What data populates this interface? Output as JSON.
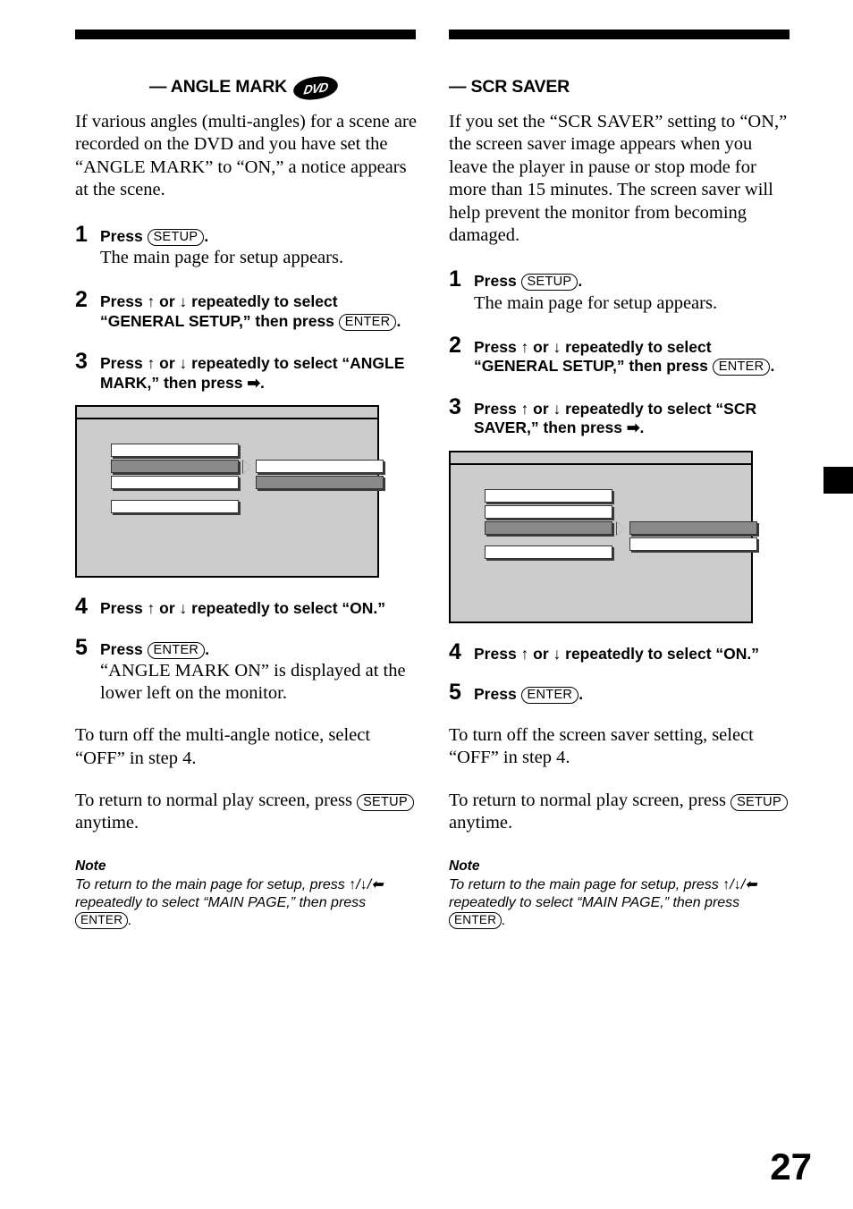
{
  "page": {
    "number": "27",
    "edge_tab_color": "#000000"
  },
  "left_column": {
    "heading": "— ANGLE MARK",
    "heading_badge": "DVD",
    "intro": "If various angles (multi-angles) for a scene are recorded on the DVD and you have set the “ANGLE MARK” to “ON,” a notice appears at the scene.",
    "steps": [
      {
        "num": "1",
        "bold_pre": "Press ",
        "key": "SETUP",
        "bold_post": ".",
        "sub": "The main page for setup appears."
      },
      {
        "num": "2",
        "bold_pre": "Press ↑ or ↓ repeatedly to select “GENERAL SETUP,” then press ",
        "key": "ENTER",
        "bold_post": ".",
        "sub": ""
      },
      {
        "num": "3",
        "bold_pre": "Press ↑ or ↓ repeatedly to select “ANGLE MARK,” then press ➡.",
        "key": "",
        "bold_post": "",
        "sub": ""
      },
      {
        "num": "4",
        "bold_pre": "Press ↑ or ↓ repeatedly to select “ON.”",
        "key": "",
        "bold_post": "",
        "sub": ""
      },
      {
        "num": "5",
        "bold_pre": "Press ",
        "key": "ENTER",
        "bold_post": ".",
        "sub": "“ANGLE MARK ON” is displayed at the lower left on the monitor."
      }
    ],
    "after_steps": "To turn off the multi-angle notice, select “OFF” in step 4.",
    "return_pre": "To return to normal play screen, press ",
    "return_key": "SETUP",
    "return_post": " anytime.",
    "note_title": "Note",
    "note_pre": "To return to the main page for setup, press ↑/↓/⬅ repeatedly to select “MAIN PAGE,” then press ",
    "note_key": "ENTER",
    "note_post": "."
  },
  "right_column": {
    "heading": "— SCR SAVER",
    "intro": "If you set the “SCR SAVER” setting to “ON,” the screen saver image appears when you leave the player in pause or stop mode for more than 15 minutes. The screen saver will help prevent the monitor from becoming damaged.",
    "steps": [
      {
        "num": "1",
        "bold_pre": "Press ",
        "key": "SETUP",
        "bold_post": ".",
        "sub": "The main page for setup appears."
      },
      {
        "num": "2",
        "bold_pre": "Press ↑ or ↓ repeatedly to select “GENERAL SETUP,” then press ",
        "key": "ENTER",
        "bold_post": ".",
        "sub": ""
      },
      {
        "num": "3",
        "bold_pre": "Press ↑ or ↓ repeatedly to select “SCR SAVER,” then press ➡.",
        "key": "",
        "bold_post": "",
        "sub": ""
      },
      {
        "num": "4",
        "bold_pre": "Press ↑ or ↓ repeatedly to select “ON.”",
        "key": "",
        "bold_post": "",
        "sub": ""
      },
      {
        "num": "5",
        "bold_pre": "Press ",
        "key": "ENTER",
        "bold_post": ".",
        "sub": ""
      }
    ],
    "after_steps": "To turn off the screen saver setting, select “OFF” in step 4.",
    "return_pre": "To return to normal play screen, press ",
    "return_key": "SETUP",
    "return_post": " anytime.",
    "note_title": "Note",
    "note_pre": "To return to the main page for setup, press ↑/↓/⬅ repeatedly to select “MAIN PAGE,” then press ",
    "note_key": "ENTER",
    "note_post": "."
  },
  "illustrations": {
    "left": {
      "selected_menu_index": 1,
      "selected_submenu_index": 1,
      "menu_item_count": 4,
      "submenu_item_count": 2,
      "background_color": "#cccccc",
      "highlight_color": "#8a8a8a"
    },
    "right": {
      "selected_menu_index": 2,
      "selected_submenu_index": 0,
      "menu_item_count": 4,
      "submenu_item_count": 2,
      "background_color": "#cccccc",
      "highlight_color": "#8a8a8a"
    }
  }
}
